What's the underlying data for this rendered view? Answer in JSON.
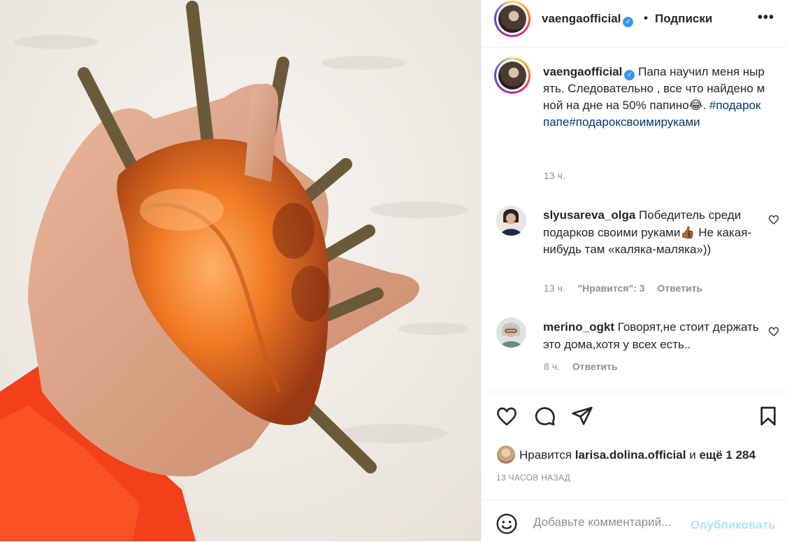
{
  "post": {
    "username": "vaengaofficial",
    "follow_label": "Подписки",
    "dot": "•",
    "more": "•••",
    "caption_text": "Папа научил меня нырять. Следовательно , все что найдено мной на дне на 50% папино😂.",
    "hashtags": "#подарокпапе#подароксвоимируками",
    "caption_time": "13 ч."
  },
  "comments": [
    {
      "username": "slyusareva_olga",
      "text": "Победитель среди подарков своими руками👍🏾 Не какая-нибудь там «каляка-маляка»))",
      "time": "13 ч.",
      "likes": "\"Нравится\": 3",
      "reply": "Ответить"
    },
    {
      "username": "merino_ogkt",
      "text": "Говорят,не стоит держать это дома,хотя у всех есть..",
      "time": "8 ч.",
      "reply": "Ответить"
    }
  ],
  "likes": {
    "prefix": "Нравится",
    "user": "larisa.dolina.official",
    "middle": "и",
    "more": "ещё 1 284"
  },
  "post_time": "13 ЧАСОВ НАЗАД",
  "comment_box": {
    "placeholder": "Добавьте комментарий...",
    "publish": "Опубликовать"
  },
  "colors": {
    "accent": "#3897f0",
    "hashtag": "#00376b",
    "muted": "#8e8e8e",
    "publish_disabled": "#b2dffc"
  }
}
